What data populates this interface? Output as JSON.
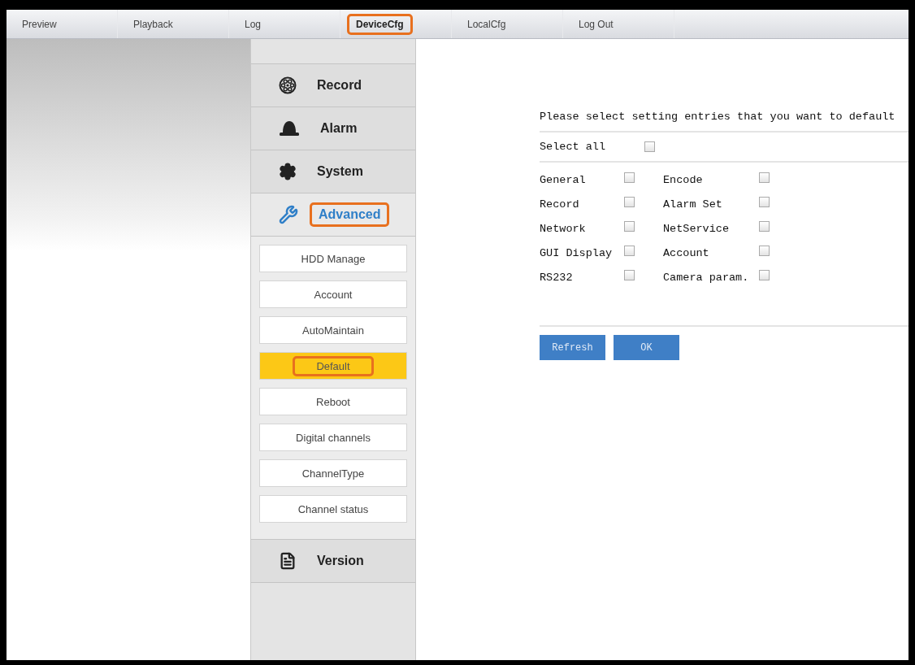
{
  "nav": {
    "tabs": [
      {
        "label": "Preview",
        "selected": false,
        "highlighted": false
      },
      {
        "label": "Playback",
        "selected": false,
        "highlighted": false
      },
      {
        "label": "Log",
        "selected": false,
        "highlighted": false
      },
      {
        "label": "DeviceCfg",
        "selected": true,
        "highlighted": true
      },
      {
        "label": "LocalCfg",
        "selected": false,
        "highlighted": false
      },
      {
        "label": "Log Out",
        "selected": false,
        "highlighted": false
      }
    ]
  },
  "sidebar": {
    "items": [
      {
        "kind": "record",
        "label": "Record",
        "selected": false,
        "highlighted": false
      },
      {
        "kind": "alarm",
        "label": "Alarm",
        "selected": false,
        "highlighted": false
      },
      {
        "kind": "system",
        "label": "System",
        "selected": false,
        "highlighted": false
      },
      {
        "kind": "advanced",
        "label": "Advanced",
        "selected": true,
        "highlighted": true,
        "children": [
          {
            "label": "HDD Manage",
            "selected": false,
            "highlighted": false
          },
          {
            "label": "Account",
            "selected": false,
            "highlighted": false
          },
          {
            "label": "AutoMaintain",
            "selected": false,
            "highlighted": false
          },
          {
            "label": "Default",
            "selected": true,
            "highlighted": true
          },
          {
            "label": "Reboot",
            "selected": false,
            "highlighted": false
          },
          {
            "label": "Digital channels",
            "selected": false,
            "highlighted": false
          },
          {
            "label": "ChannelType",
            "selected": false,
            "highlighted": false
          },
          {
            "label": "Channel status",
            "selected": false,
            "highlighted": false
          }
        ]
      },
      {
        "kind": "version",
        "label": "Version",
        "selected": false,
        "highlighted": false
      }
    ]
  },
  "content": {
    "title": "Please select setting entries that you want to default",
    "select_all": {
      "label": "Select all",
      "checked": false
    },
    "options": [
      {
        "label": "General",
        "checked": false
      },
      {
        "label": "Encode",
        "checked": false
      },
      {
        "label": "Record",
        "checked": false
      },
      {
        "label": "Alarm Set",
        "checked": false
      },
      {
        "label": "Network",
        "checked": false
      },
      {
        "label": "NetService",
        "checked": false
      },
      {
        "label": "GUI Display",
        "checked": false
      },
      {
        "label": "Account",
        "checked": false
      },
      {
        "label": "RS232",
        "checked": false
      },
      {
        "label": "Camera param.",
        "checked": false
      }
    ],
    "buttons": [
      "Refresh",
      "OK"
    ]
  }
}
